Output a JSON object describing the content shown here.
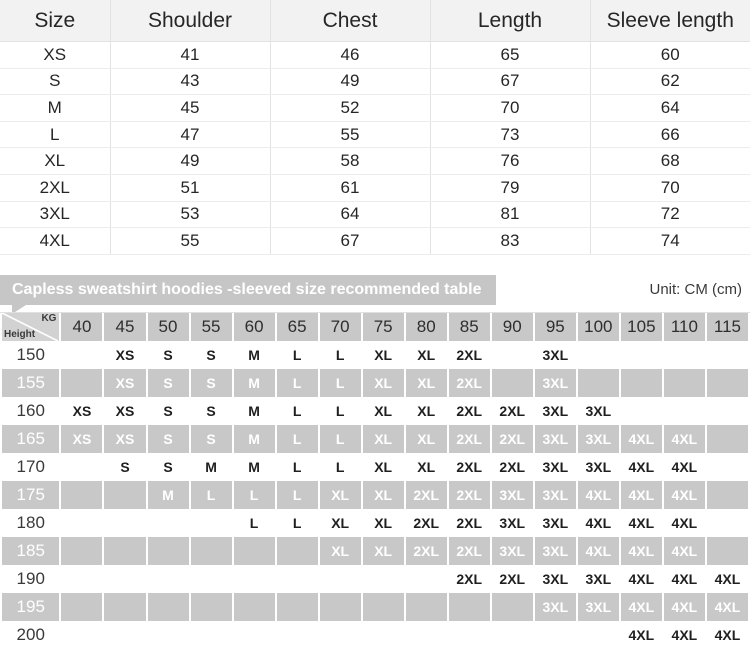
{
  "measure_table": {
    "headers": [
      "Size",
      "Shoulder",
      "Chest",
      "Length",
      "Sleeve length"
    ],
    "rows": [
      {
        "size": "XS",
        "shoulder": "41",
        "chest": "46",
        "length": "65",
        "sleeve": "60"
      },
      {
        "size": "S",
        "shoulder": "43",
        "chest": "49",
        "length": "67",
        "sleeve": "62"
      },
      {
        "size": "M",
        "shoulder": "45",
        "chest": "52",
        "length": "70",
        "sleeve": "64"
      },
      {
        "size": "L",
        "shoulder": "47",
        "chest": "55",
        "length": "73",
        "sleeve": "66"
      },
      {
        "size": "XL",
        "shoulder": "49",
        "chest": "58",
        "length": "76",
        "sleeve": "68"
      },
      {
        "size": "2XL",
        "shoulder": "51",
        "chest": "61",
        "length": "79",
        "sleeve": "70"
      },
      {
        "size": "3XL",
        "shoulder": "53",
        "chest": "64",
        "length": "81",
        "sleeve": "72"
      },
      {
        "size": "4XL",
        "shoulder": "55",
        "chest": "67",
        "length": "83",
        "sleeve": "74"
      }
    ]
  },
  "banner": {
    "title": "Capless sweatshirt hoodies -sleeved size recommended table",
    "unit": "Unit: CM (cm)"
  },
  "grid_table": {
    "corner": {
      "kg_label": "KG",
      "height_label": "Height"
    },
    "weights": [
      "40",
      "45",
      "50",
      "55",
      "60",
      "65",
      "70",
      "75",
      "80",
      "85",
      "90",
      "95",
      "100",
      "105",
      "110",
      "115"
    ],
    "rows": [
      {
        "height": "150",
        "cells": [
          "",
          "XS",
          "S",
          "S",
          "M",
          "L",
          "L",
          "XL",
          "XL",
          "2XL",
          "",
          "3XL",
          "",
          "",
          "",
          ""
        ]
      },
      {
        "height": "155",
        "cells": [
          "",
          "XS",
          "S",
          "S",
          "M",
          "L",
          "L",
          "XL",
          "XL",
          "2XL",
          "",
          "3XL",
          "",
          "",
          "",
          ""
        ]
      },
      {
        "height": "160",
        "cells": [
          "XS",
          "XS",
          "S",
          "S",
          "M",
          "L",
          "L",
          "XL",
          "XL",
          "2XL",
          "2XL",
          "3XL",
          "3XL",
          "",
          "",
          ""
        ]
      },
      {
        "height": "165",
        "cells": [
          "XS",
          "XS",
          "S",
          "S",
          "M",
          "L",
          "L",
          "XL",
          "XL",
          "2XL",
          "2XL",
          "3XL",
          "3XL",
          "4XL",
          "4XL",
          ""
        ]
      },
      {
        "height": "170",
        "cells": [
          "",
          "S",
          "S",
          "M",
          "M",
          "L",
          "L",
          "XL",
          "XL",
          "2XL",
          "2XL",
          "3XL",
          "3XL",
          "4XL",
          "4XL",
          ""
        ]
      },
      {
        "height": "175",
        "cells": [
          "",
          "",
          "M",
          "L",
          "L",
          "L",
          "XL",
          "XL",
          "2XL",
          "2XL",
          "3XL",
          "3XL",
          "4XL",
          "4XL",
          "4XL",
          ""
        ]
      },
      {
        "height": "180",
        "cells": [
          "",
          "",
          "",
          "",
          "L",
          "L",
          "XL",
          "XL",
          "2XL",
          "2XL",
          "3XL",
          "3XL",
          "4XL",
          "4XL",
          "4XL",
          ""
        ]
      },
      {
        "height": "185",
        "cells": [
          "",
          "",
          "",
          "",
          "",
          "",
          "XL",
          "XL",
          "2XL",
          "2XL",
          "3XL",
          "3XL",
          "4XL",
          "4XL",
          "4XL",
          ""
        ]
      },
      {
        "height": "190",
        "cells": [
          "",
          "",
          "",
          "",
          "",
          "",
          "",
          "",
          "",
          "2XL",
          "2XL",
          "3XL",
          "3XL",
          "4XL",
          "4XL",
          "4XL"
        ]
      },
      {
        "height": "195",
        "cells": [
          "",
          "",
          "",
          "",
          "",
          "",
          "",
          "",
          "",
          "",
          "",
          "3XL",
          "3XL",
          "4XL",
          "4XL",
          "4XL"
        ]
      },
      {
        "height": "200",
        "cells": [
          "",
          "",
          "",
          "",
          "",
          "",
          "",
          "",
          "",
          "",
          "",
          "",
          "",
          "4XL",
          "4XL",
          "4XL"
        ]
      }
    ]
  },
  "colors": {
    "header_bg": "#f2f2f2",
    "banner_bg": "#c6c6c6",
    "grid_head_bg": "#c8c8c8",
    "band_dark_bg": "#c8c8c8",
    "band_light_bg": "#ffffff",
    "text_dark": "#1f1f1f",
    "text_light": "#ffffff"
  }
}
